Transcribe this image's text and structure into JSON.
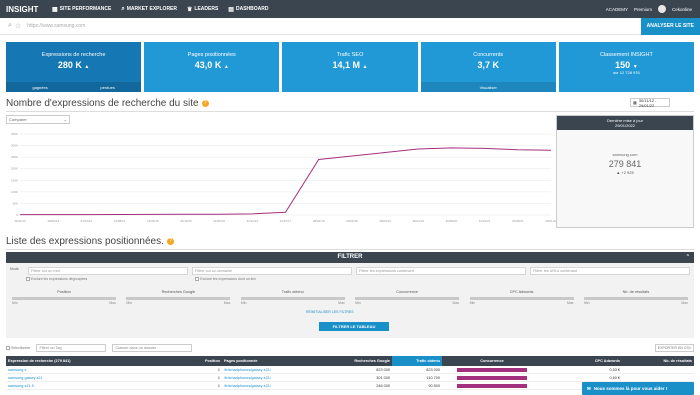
{
  "topnav": {
    "brand": "INSIGHT",
    "items": [
      {
        "label": "SITE PERFORMANCE",
        "icon": "bar-chart-icon"
      },
      {
        "label": "MARKET EXPLORER",
        "icon": "search-icon"
      },
      {
        "label": "LEADERS",
        "icon": "trophy-icon"
      },
      {
        "label": "DASHBOARD",
        "icon": "grid-icon"
      }
    ],
    "right_links": [
      "ACADEMY",
      "Premium"
    ],
    "user": "Cekonline"
  },
  "urlbar": {
    "placeholder": "https://www.samsung.com",
    "analyse_label": "ANALYSER LE SITE"
  },
  "kpis": [
    {
      "label": "Expressions de recherche",
      "value": "280 K",
      "trend": "▲",
      "sub_left": "gagnées",
      "sub_right": "perdues",
      "active": true
    },
    {
      "label": "Pages positionnées",
      "value": "43,0 K",
      "trend": "▲"
    },
    {
      "label": "Trafic SEO",
      "value": "14,1 M",
      "trend": "▲"
    },
    {
      "label": "Concurrents",
      "value": "3,7 K",
      "note": "Visualiser"
    },
    {
      "label": "Classement INSIGHT",
      "value": "150",
      "trend": "▼",
      "note": "sur 12 728 976"
    }
  ],
  "section1": {
    "title": "Nombre d'expressions de recherche du site",
    "date_range": "30/11/12 - 29/01/22",
    "compare_label": "Comparer"
  },
  "chart_data": {
    "type": "line",
    "x": [
      "30/11/12",
      "30/06/13",
      "31/01/14",
      "31/08/14",
      "31/03/15",
      "31/10/15",
      "31/05/16",
      "31/12/16",
      "31/07/17",
      "28/02/18",
      "30/09/18",
      "30/04/19",
      "30/11/19",
      "30/06/20",
      "31/01/21",
      "31/08/21",
      "29/01/22"
    ],
    "series": [
      {
        "name": "samsung.com",
        "values": [
          1500,
          1600,
          1800,
          2000,
          2500,
          3000,
          3500,
          5000,
          12000,
          240000,
          255000,
          270000,
          285000,
          290000,
          288000,
          282000,
          279841
        ]
      }
    ],
    "ylim": [
      0,
      350000
    ],
    "yticks": [
      "0",
      "50K",
      "100K",
      "150K",
      "200K",
      "250K",
      "300K",
      "350K"
    ],
    "line_color": "#a4307f"
  },
  "sidebox": {
    "header": "Dernière mise à jour",
    "date": "29/01/2022",
    "site": "samsung.com",
    "value": "279 841",
    "delta": "▲ +2 925"
  },
  "section2": {
    "title": "Liste des expressions positionnées."
  },
  "filter": {
    "title": "FILTRER",
    "mode_label": "Mode",
    "inputs": [
      "Filtrer sur un mot",
      "Filtrer sur un domaine",
      "Filtrer les expressions contenant",
      "Filtrer les URLs contenant"
    ],
    "checks": [
      "Exclure les expressions dégroupées",
      "Exclure les expressions dont un lien"
    ],
    "sliders": [
      {
        "label": "Position",
        "min": "Min",
        "max": "Max"
      },
      {
        "label": "Recherches Google",
        "min": "Min",
        "max": "Max"
      },
      {
        "label": "Trafic obtenu",
        "min": "Min",
        "max": "Max"
      },
      {
        "label": "Concurrence",
        "min": "Min",
        "max": "Max"
      },
      {
        "label": "CPC Adwords",
        "min": "Min",
        "max": "Max"
      },
      {
        "label": "Nb. de résultats",
        "min": "Min",
        "max": "Max"
      }
    ],
    "reset_label": "RÉINITIALISER LES FILTRES",
    "apply_label": "FILTRER LE TABLEAU"
  },
  "toolbar": {
    "select_all": "Sélectionner",
    "tag_placeholder": "Filtrer un Tag",
    "sort_placeholder": "Classer dans un dossier",
    "export_label": "EXPORTER EN CSV"
  },
  "table": {
    "headers": [
      "Expression de recherche (279 841)",
      "Position",
      "Pages positionnée",
      "Recherches Google",
      "Trafic obtenu",
      "Concurrence",
      "CPC Adwords",
      "Nb. de résultats"
    ],
    "rows": [
      {
        "kw": "samsung s",
        "pos": "1",
        "url": "/fr/smartphones/galaxy-s21/",
        "searches": "823 000",
        "traffic": "823 000",
        "cpc": "0,53 €",
        "results": ""
      },
      {
        "kw": "samsung galaxy s21",
        "pos": "1",
        "url": "/fr/smartphones/galaxy-s21/",
        "searches": "301 000",
        "traffic": "110 700",
        "cpc": "0,60 €",
        "results": ""
      },
      {
        "kw": "samsung s21 5",
        "pos": "1",
        "url": "/fr/smartphones/galaxy-s21/",
        "searches": "246 000",
        "traffic": "90 500",
        "cpc": "0,45 €",
        "results": ""
      }
    ]
  },
  "chat": {
    "label": "Nous sommes là pour vous aider !"
  }
}
